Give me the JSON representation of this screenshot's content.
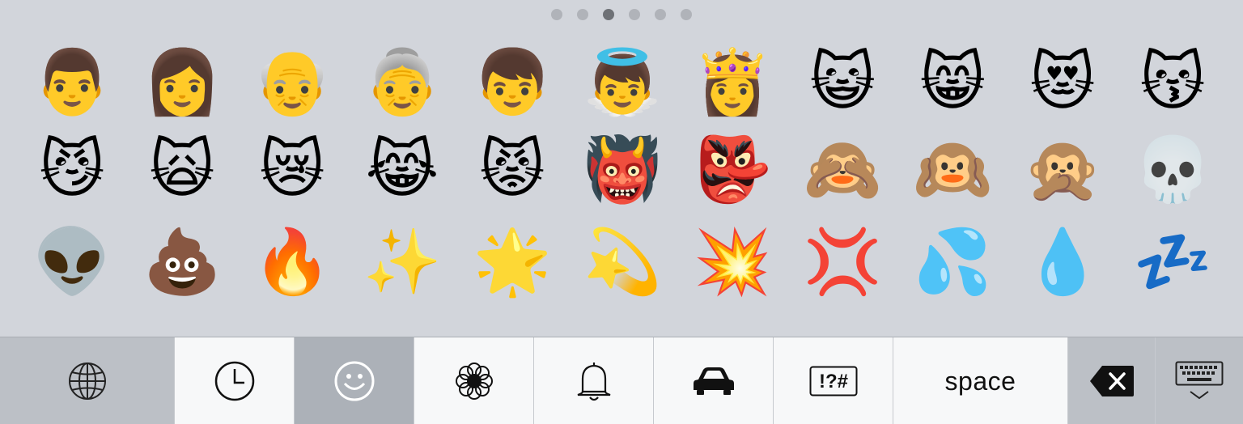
{
  "keyboard": {
    "pages": {
      "count": 6,
      "current": 3
    },
    "emoji_rows": [
      [
        "👨",
        "👩",
        "👴",
        "👵",
        "👦",
        "👼",
        "👸",
        "😺",
        "😸",
        "😻",
        "😽"
      ],
      [
        "😼",
        "🙀",
        "😿",
        "😹",
        "😾",
        "👹",
        "👺",
        "🙈",
        "🙉",
        "🙊",
        "💀"
      ],
      [
        "👽",
        "💩",
        "🔥",
        "✨",
        "🌟",
        "💫",
        "💥",
        "💢",
        "💦",
        "💧",
        "💤"
      ]
    ],
    "toolbar": {
      "globe_icon": "globe-icon",
      "recent_icon": "clock-icon",
      "people_icon": "smiley-icon",
      "nature_icon": "flower-icon",
      "objects_icon": "bell-icon",
      "places_icon": "car-icon",
      "symbols_label": "!?#",
      "space_label": "space",
      "delete_icon": "backspace-icon",
      "dismiss_icon": "keyboard-dismiss-icon"
    },
    "colors": {
      "background": "#d2d5db",
      "key_light": "#f7f8f9",
      "key_dark": "#bcc0c6",
      "key_selected": "#acb1b8",
      "dot_active": "#6e7176",
      "dot_inactive": "#b0b3b9"
    }
  }
}
